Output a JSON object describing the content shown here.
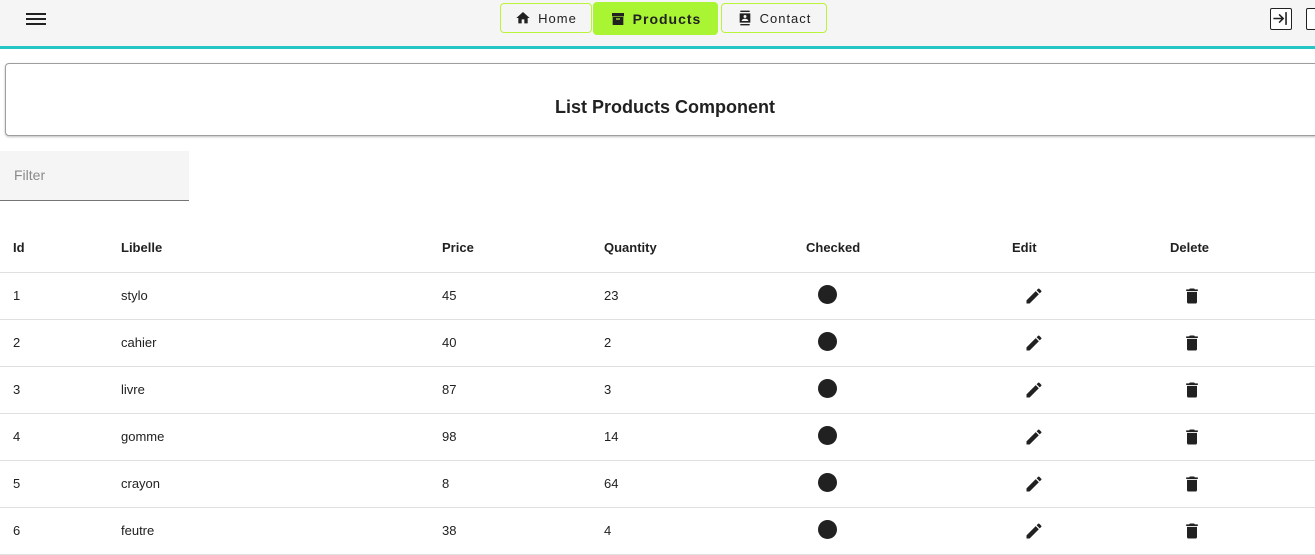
{
  "toolbar": {
    "nav": [
      {
        "label": "Home",
        "icon": "home-icon"
      },
      {
        "label": "Products",
        "icon": "archive-icon",
        "active": true
      },
      {
        "label": "Contact",
        "icon": "contact-card-icon"
      }
    ],
    "right_icons": [
      "login-icon",
      "logout-icon"
    ],
    "accent_color": "#a9f534",
    "underline_color": "#26c6c6"
  },
  "page": {
    "title": "List Products Component"
  },
  "filter": {
    "placeholder": "Filter",
    "value": ""
  },
  "table": {
    "columns": [
      "Id",
      "Libelle",
      "Price",
      "Quantity",
      "Checked",
      "Edit",
      "Delete"
    ],
    "rows": [
      {
        "id": "1",
        "libelle": "stylo",
        "price": "45",
        "quantity": "23"
      },
      {
        "id": "2",
        "libelle": "cahier",
        "price": "40",
        "quantity": "2"
      },
      {
        "id": "3",
        "libelle": "livre",
        "price": "87",
        "quantity": "3"
      },
      {
        "id": "4",
        "libelle": "gomme",
        "price": "98",
        "quantity": "14"
      },
      {
        "id": "5",
        "libelle": "crayon",
        "price": "8",
        "quantity": "64"
      },
      {
        "id": "6",
        "libelle": "feutre",
        "price": "38",
        "quantity": "4"
      }
    ]
  }
}
